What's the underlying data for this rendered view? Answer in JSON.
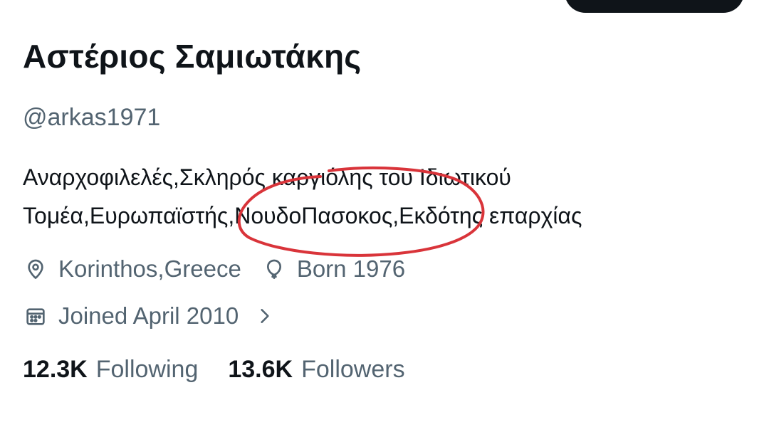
{
  "profile": {
    "display_name": "Αστέριος Σαμιωτάκης",
    "handle": "@arkas1971",
    "bio": "Αναρχοφιλελές,Σκληρός καργιόλης του Ιδιωτικού\nΤομέα,Ευρωπαϊστής,ΝουδοΠασοκος,Εκδότης επαρχίας"
  },
  "meta": {
    "location": "Korinthos,Greece",
    "location_icon": "location-pin-icon",
    "birth": "Born 1976",
    "birth_icon": "balloon-icon",
    "joined": "Joined April 2010",
    "joined_icon": "calendar-icon"
  },
  "stats": {
    "following_count": "12.3K",
    "following_label": "Following",
    "followers_count": "13.6K",
    "followers_label": "Followers"
  },
  "annotation": {
    "color": "#d9343a"
  },
  "colors": {
    "text_primary": "#0f1419",
    "text_secondary": "#536471"
  }
}
